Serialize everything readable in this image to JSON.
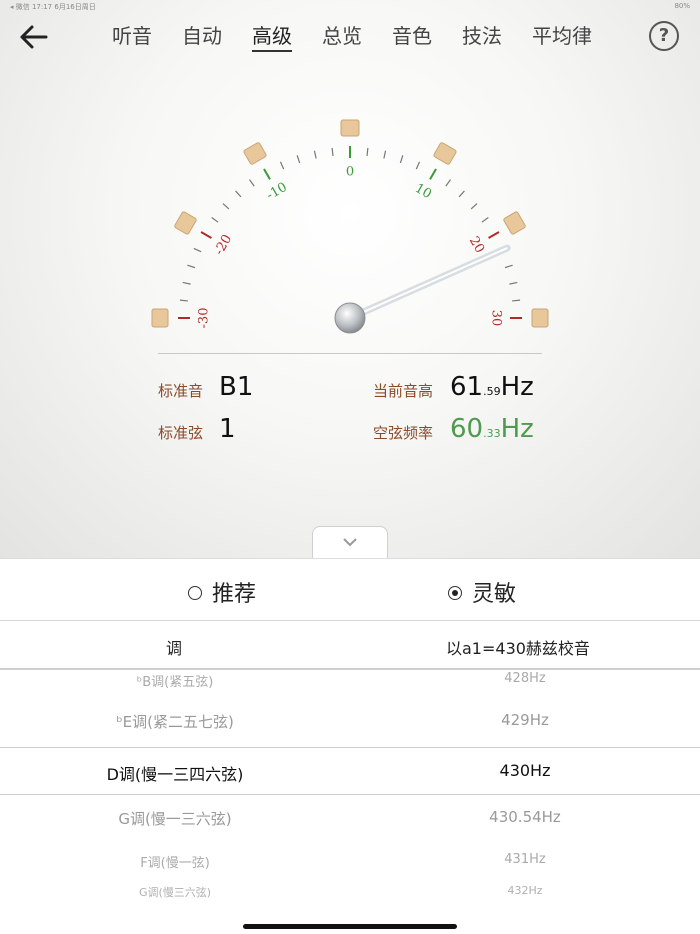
{
  "status": {
    "left": "◂ 微信   17:17   6月16日周日",
    "right": "80%"
  },
  "nav": {
    "tabs": [
      "听音",
      "自动",
      "高级",
      "总览",
      "音色",
      "技法",
      "平均律"
    ],
    "active": 2
  },
  "gauge": {
    "min": -30,
    "max": 30,
    "needle_value": 22,
    "labels": [
      "-30",
      "-20",
      "-10",
      "0",
      "10",
      "20",
      "30"
    ],
    "colors": {
      "center": "#3a9a3a",
      "mid": "#3a9a3a",
      "outer": "#b02a2a"
    }
  },
  "readout": {
    "std_note_label": "标准音",
    "std_note_value": "B1",
    "std_string_label": "标准弦",
    "std_string_value": "1",
    "cur_pitch_label": "当前音高",
    "cur_pitch_int": "61",
    "cur_pitch_dec": ".59",
    "cur_pitch_unit": "Hz",
    "open_freq_label": "空弦频率",
    "open_freq_int": "60",
    "open_freq_dec": ".33",
    "open_freq_unit": "Hz"
  },
  "modes": {
    "recommended": "推荐",
    "sensitive": "灵敏",
    "selected": "sensitive"
  },
  "table": {
    "col1": "调",
    "col2": "以a1=430赫兹校音",
    "rows": [
      {
        "key": "ᵇB调(紧五弦)",
        "freq": "428Hz"
      },
      {
        "key": "ᵇE调(紧二五七弦)",
        "freq": "429Hz"
      },
      {
        "key": "D调(慢一三四六弦)",
        "freq": "430Hz"
      },
      {
        "key": "G调(慢一三六弦)",
        "freq": "430.54Hz"
      },
      {
        "key": "F调(慢一弦)",
        "freq": "431Hz"
      },
      {
        "key": "G调(慢三六弦)",
        "freq": "432Hz"
      }
    ]
  }
}
